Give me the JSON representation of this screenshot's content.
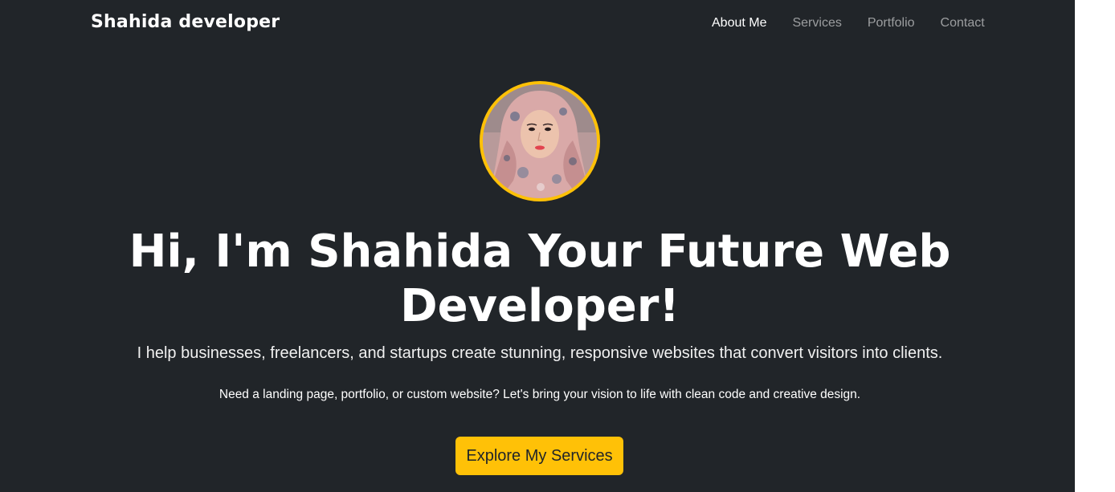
{
  "navbar": {
    "brand": "Shahida developer",
    "links": [
      {
        "label": "About Me",
        "active": true
      },
      {
        "label": "Services",
        "active": false
      },
      {
        "label": "Portfolio",
        "active": false
      },
      {
        "label": "Contact",
        "active": false
      }
    ]
  },
  "hero": {
    "avatar_icon": "profile-photo",
    "title": "Hi, I'm Shahida Your Future Web Developer!",
    "lead": "I help businesses, freelancers, and startups create stunning, responsive websites that convert visitors into clients.",
    "subtext": "Need a landing page, portfolio, or custom website? Let's bring your vision to life with clean code and creative design.",
    "cta_label": "Explore My Services"
  },
  "colors": {
    "background": "#212529",
    "accent": "#ffc107",
    "text": "#ffffff"
  }
}
